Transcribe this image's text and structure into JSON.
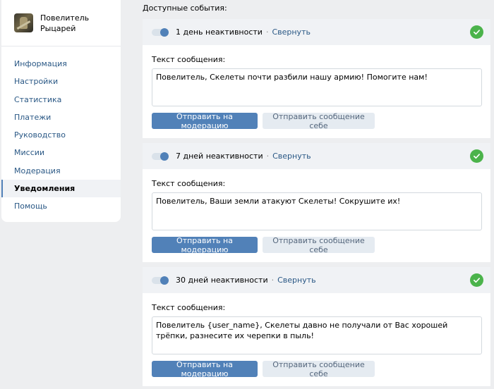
{
  "app": {
    "name": "Повелитель Рыцарей"
  },
  "menu": [
    {
      "label": "Информация",
      "active": false
    },
    {
      "label": "Настройки",
      "active": false
    },
    {
      "label": "Статистика",
      "active": false
    },
    {
      "label": "Платежи",
      "active": false
    },
    {
      "label": "Руководство",
      "active": false
    },
    {
      "label": "Миссии",
      "active": false
    },
    {
      "label": "Модерация",
      "active": false
    },
    {
      "label": "Уведомления",
      "active": true
    },
    {
      "label": "Помощь",
      "active": false
    }
  ],
  "content": {
    "title": "Доступные события:"
  },
  "events": [
    {
      "title": "1 день неактивности",
      "collapse_label": "Свернуть",
      "enabled": true,
      "field_label": "Текст сообщения:",
      "message": "Повелитель, Скелеты почти разбили нашу армию! Помогите нам!",
      "submit_label": "Отправить на модерацию",
      "self_label": "Отправить сообщение себе"
    },
    {
      "title": "7 дней неактивности",
      "collapse_label": "Свернуть",
      "enabled": true,
      "field_label": "Текст сообщения:",
      "message": "Повелитель, Ваши земли атакуют Скелеты! Сокрушите их!",
      "submit_label": "Отправить на модерацию",
      "self_label": "Отправить сообщение себе"
    },
    {
      "title": "30 дней неактивности",
      "collapse_label": "Свернуть",
      "enabled": true,
      "field_label": "Текст сообщения:",
      "message": "Повелитель {user_name}, Скелеты давно не получали от Вас хорошей трёпки, разнесите их черепки в пыль!",
      "submit_label": "Отправить на модерацию",
      "self_label": "Отправить сообщение себе"
    }
  ],
  "colors": {
    "accent": "#5181b8",
    "link": "#2a5885",
    "success": "#4bb34b",
    "background": "#edeef0"
  }
}
